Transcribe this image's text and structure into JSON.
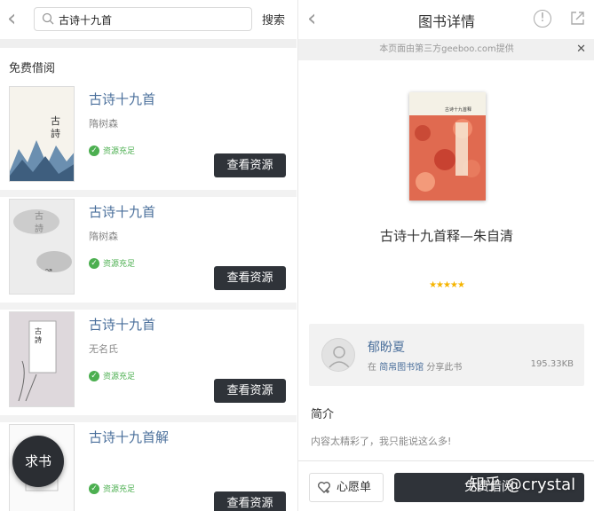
{
  "left_panel": {
    "search": {
      "value": "古诗十九首",
      "button_label": "搜索"
    },
    "section_title": "免费借阅",
    "books": [
      {
        "title": "古诗十九首",
        "author": "隋树森",
        "availability": "资源充足",
        "button_label": "查看资源"
      },
      {
        "title": "古诗十九首",
        "author": "隋树森",
        "availability": "资源充足",
        "button_label": "查看资源"
      },
      {
        "title": "古诗十九首",
        "author": "无名氏",
        "availability": "资源充足",
        "button_label": "查看资源"
      },
      {
        "title": "古诗十九首解",
        "author": "",
        "availability": "资源充足",
        "button_label": "查看资源"
      }
    ],
    "fab_label": "求书"
  },
  "right_panel": {
    "header_title": "图书详情",
    "notice": "本页面由第三方geeboo.com提供",
    "book_title": "古诗十九首释—朱自清",
    "rating_stars": 5,
    "stars_text": "★★★★★",
    "sharer": {
      "name": "郁盼夏",
      "prefix": "在",
      "library": "简帛图书馆",
      "suffix": "分享此书",
      "file_size": "195.33KB"
    },
    "intro_title": "简介",
    "intro_text": "内容太精彩了，我只能说这么多!",
    "wish_button": "心愿单",
    "borrow_button": "免费借阅",
    "cover_label": "古诗十九首释"
  },
  "watermark": "知乎 @crystal",
  "colors": {
    "accent_text": "#4a6f9b",
    "dark_button": "#2f3339",
    "available_green": "#4caf50",
    "star": "#f5b400"
  }
}
